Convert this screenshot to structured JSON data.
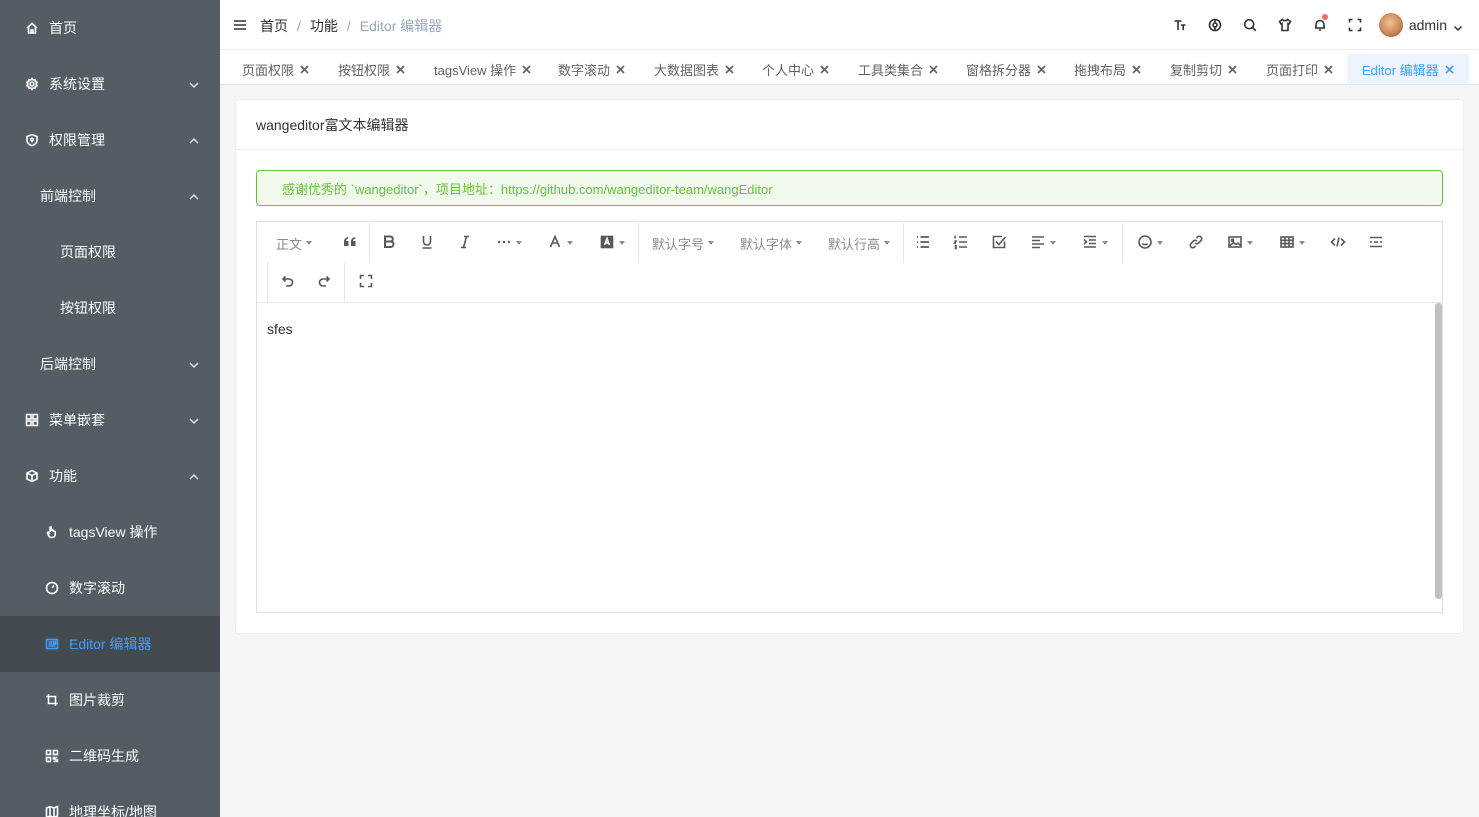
{
  "sidebar": {
    "items": [
      {
        "label": "首页"
      },
      {
        "label": "系统设置"
      },
      {
        "label": "权限管理"
      },
      {
        "label": "前端控制"
      },
      {
        "label": "页面权限"
      },
      {
        "label": "按钮权限"
      },
      {
        "label": "后端控制"
      },
      {
        "label": "菜单嵌套"
      },
      {
        "label": "功能"
      },
      {
        "label": "tagsView 操作"
      },
      {
        "label": "数字滚动"
      },
      {
        "label": "Editor 编辑器"
      },
      {
        "label": "图片裁剪"
      },
      {
        "label": "二维码生成"
      },
      {
        "label": "地理坐标/地图"
      }
    ]
  },
  "header": {
    "breadcrumb": [
      "首页",
      "功能",
      "Editor 编辑器"
    ],
    "separator": "/",
    "user": "admin"
  },
  "tags": [
    {
      "label": "页面权限"
    },
    {
      "label": "按钮权限"
    },
    {
      "label": "tagsView 操作"
    },
    {
      "label": "数字滚动"
    },
    {
      "label": "大数据图表"
    },
    {
      "label": "个人中心"
    },
    {
      "label": "工具类集合"
    },
    {
      "label": "窗格拆分器"
    },
    {
      "label": "拖拽布局"
    },
    {
      "label": "复制剪切"
    },
    {
      "label": "页面打印"
    },
    {
      "label": "Editor 编辑器"
    }
  ],
  "card": {
    "title": "wangeditor富文本编辑器",
    "alert": "感谢优秀的 `wangeditor`，项目地址：https://github.com/wangeditor-team/wangEditor"
  },
  "editor": {
    "toolbar": {
      "heading": "正文",
      "font_size": "默认字号",
      "font_family": "默认字体",
      "line_height": "默认行高"
    },
    "content": "sfes"
  },
  "colors": {
    "sidebar_bg": "#545c64",
    "sidebar_active_bg": "#434a50",
    "accent": "#409eff",
    "alert_green": "#67c23a"
  }
}
